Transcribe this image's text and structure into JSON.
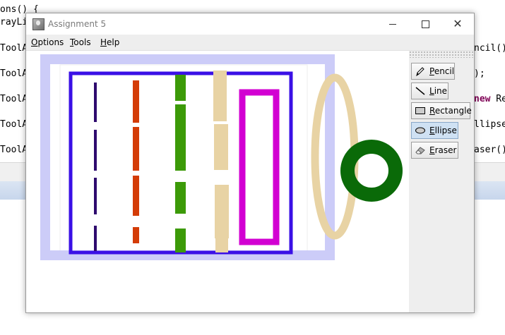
{
  "ide": {
    "code_lines": [
      {
        "left": "ons() {",
        "right": ""
      },
      {
        "left": "rayLi",
        "right": ""
      },
      {
        "left": "ToolA",
        "right": "ncil());"
      },
      {
        "left": "ToolA",
        "right": ");"
      },
      {
        "left": "ToolA",
        "right_kw": "new",
        "right": " Rec"
      },
      {
        "left": "ToolA",
        "right": "llipse"
      },
      {
        "left": "ToolA",
        "right": "aser());"
      }
    ]
  },
  "window": {
    "title": "Assignment 5",
    "controls": {
      "minimize": "",
      "maximize": "",
      "close": "✕"
    }
  },
  "menu": [
    {
      "mnemonic": "O",
      "rest": "ptions"
    },
    {
      "mnemonic": "T",
      "rest": "ools"
    },
    {
      "mnemonic": "H",
      "rest": "elp"
    }
  ],
  "tools": {
    "selected": "Ellipse",
    "items": [
      {
        "name": "Pencil",
        "mnemonic": "P",
        "rest": "encil",
        "icon": "pencil-icon"
      },
      {
        "name": "Line",
        "mnemonic": "L",
        "rest": "ine",
        "icon": "line-icon"
      },
      {
        "name": "Rectangle",
        "mnemonic": "R",
        "rest": "ectangle",
        "icon": "rectangle-icon"
      },
      {
        "name": "Ellipse",
        "mnemonic": "E",
        "rest": "llipse",
        "icon": "ellipse-icon"
      },
      {
        "name": "Eraser",
        "mnemonic": "E",
        "rest": "raser",
        "icon": "eraser-icon"
      }
    ]
  },
  "colors": {
    "light_blue_rect": "#ccccf8",
    "blue_rect": "#3a10e6",
    "purple_line": "#2e0a6e",
    "orange_line": "#d43c07",
    "green_line": "#3c9a08",
    "tan": "#e8d3a4",
    "magenta_rect": "#d200d2",
    "dark_green_ring": "#0a6a08",
    "selected_tool_bg": "#cfe1f3"
  }
}
